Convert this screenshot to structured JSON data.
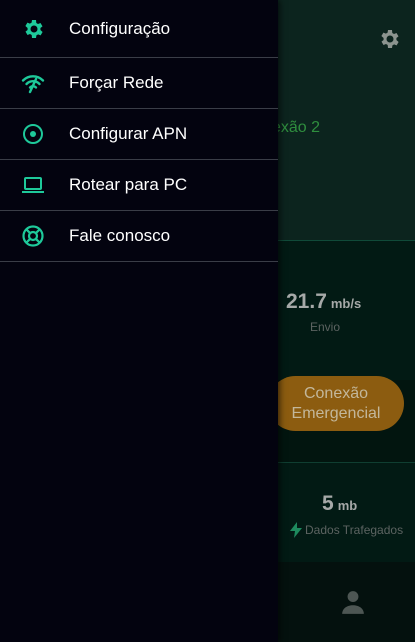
{
  "menu": {
    "items": [
      {
        "label": "Configuração",
        "icon": "gear-icon"
      },
      {
        "label": "Forçar Rede",
        "icon": "signal-icon"
      },
      {
        "label": "Configurar APN",
        "icon": "radio-target-icon"
      },
      {
        "label": "Rotear para PC",
        "icon": "laptop-icon"
      },
      {
        "label": "Fale conosco",
        "icon": "lifebuoy-icon"
      }
    ]
  },
  "background": {
    "connection_title": "exão 2",
    "upload": {
      "value": "21.7",
      "unit": "mb/s",
      "label": "Envio"
    },
    "emergency_button": {
      "line1": "Conexão",
      "line2": "Emergencial"
    },
    "data": {
      "value": "5",
      "unit": "mb",
      "label": "Dados Trafegados"
    }
  },
  "colors": {
    "accent": "#1ec99a",
    "drawer_bg": "#03030f",
    "divider": "#3a3d47",
    "emergency": "#8c5c10"
  }
}
